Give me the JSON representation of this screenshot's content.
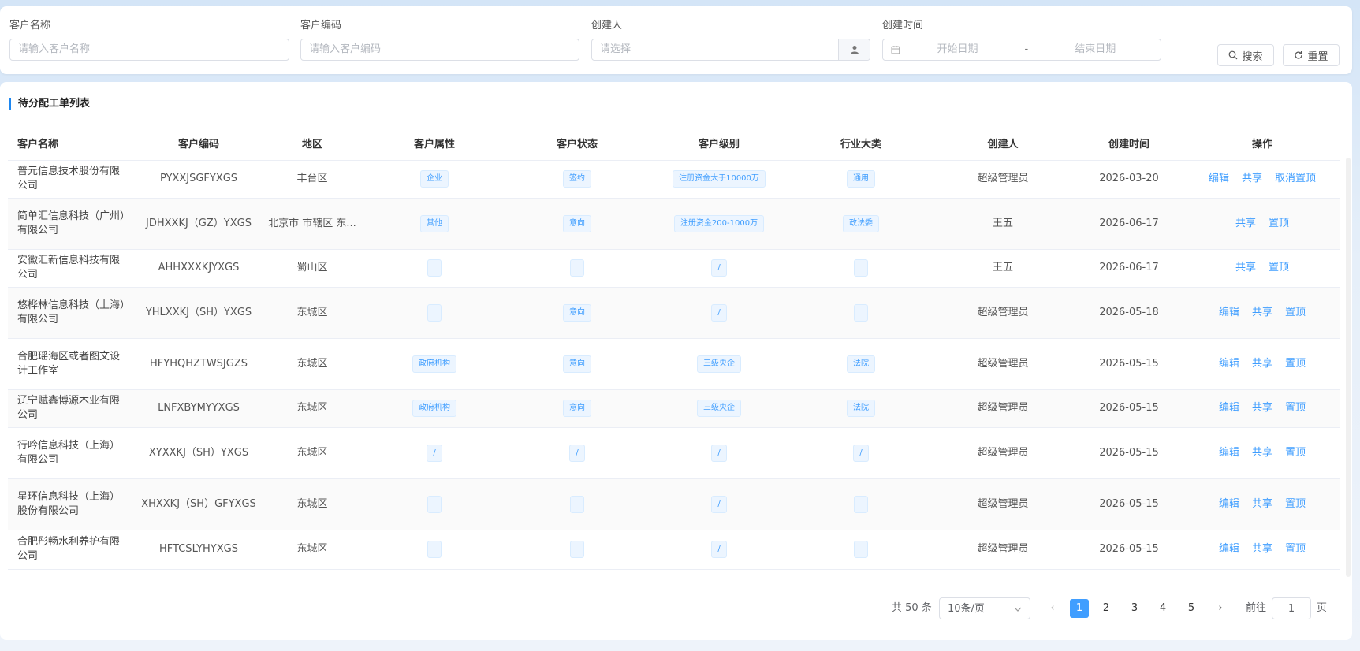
{
  "search": {
    "customer_name": {
      "label": "客户名称",
      "placeholder": "请输入客户名称"
    },
    "customer_code": {
      "label": "客户编码",
      "placeholder": "请输入客户编码"
    },
    "creator": {
      "label": "创建人",
      "placeholder": "请选择"
    },
    "create_time": {
      "label": "创建时间",
      "start_placeholder": "开始日期",
      "separator": "-",
      "end_placeholder": "结束日期"
    },
    "search_button": "搜索",
    "reset_button": "重置"
  },
  "table": {
    "title": "待分配工单列表",
    "columns": [
      "客户名称",
      "客户编码",
      "地区",
      "客户属性",
      "客户状态",
      "客户级别",
      "行业大类",
      "创建人",
      "创建时间",
      "操作"
    ],
    "rows": [
      {
        "name": "普元信息技术股份有限公司",
        "code": "PYXXJSGFYXGS",
        "region": "丰台区",
        "attr": "企业",
        "status": "签约",
        "level": "注册资金大于10000万",
        "industry": "通用",
        "creator": "超级管理员",
        "created": "2026-03-20",
        "ops": [
          "编辑",
          "共享",
          "取消置顶"
        ]
      },
      {
        "name": "简单汇信息科技（广州）有限公司",
        "code": "JDHXXKJ（GZ）YXGS",
        "region": "北京市 市辖区 东...",
        "attr": "其他",
        "status": "意向",
        "level": "注册资金200-1000万",
        "industry": "政法委",
        "creator": "王五",
        "created": "2026-06-17",
        "ops": [
          "共享",
          "置顶"
        ]
      },
      {
        "name": "安徽汇新信息科技有限公司",
        "code": "AHHXXXKJYXGS",
        "region": "蜀山区",
        "attr": "",
        "status": "",
        "level": "/",
        "industry": "",
        "creator": "王五",
        "created": "2026-06-17",
        "ops": [
          "共享",
          "置顶"
        ]
      },
      {
        "name": "悠桦林信息科技（上海）有限公司",
        "code": "YHLXXKJ（SH）YXGS",
        "region": "东城区",
        "attr": "",
        "status": "意向",
        "level": "/",
        "industry": "",
        "creator": "超级管理员",
        "created": "2026-05-18",
        "ops": [
          "编辑",
          "共享",
          "置顶"
        ]
      },
      {
        "name": "合肥瑶海区或者图文设计工作室",
        "code": "HFYHQHZTWSJGZS",
        "region": "东城区",
        "attr": "政府机构",
        "status": "意向",
        "level": "三级央企",
        "industry": "法院",
        "creator": "超级管理员",
        "created": "2026-05-15",
        "ops": [
          "编辑",
          "共享",
          "置顶"
        ]
      },
      {
        "name": "辽宁赋鑫博源木业有限公司",
        "code": "LNFXBYMYYXGS",
        "region": "东城区",
        "attr": "政府机构",
        "status": "意向",
        "level": "三级央企",
        "industry": "法院",
        "creator": "超级管理员",
        "created": "2026-05-15",
        "ops": [
          "编辑",
          "共享",
          "置顶"
        ]
      },
      {
        "name": "行吟信息科技（上海）有限公司",
        "code": "XYXXKJ（SH）YXGS",
        "region": "东城区",
        "attr": "/",
        "status": "/",
        "level": "/",
        "industry": "/",
        "creator": "超级管理员",
        "created": "2026-05-15",
        "ops": [
          "编辑",
          "共享",
          "置顶"
        ]
      },
      {
        "name": "星环信息科技（上海）股份有限公司",
        "code": "XHXXKJ（SH）GFYXGS",
        "region": "东城区",
        "attr": "",
        "status": "",
        "level": "/",
        "industry": "",
        "creator": "超级管理员",
        "created": "2026-05-15",
        "ops": [
          "编辑",
          "共享",
          "置顶"
        ]
      },
      {
        "name": "合肥彤畅水利养护有限公司",
        "code": "HFTCSLYHYXGS",
        "region": "东城区",
        "attr": "",
        "status": "",
        "level": "/",
        "industry": "",
        "creator": "超级管理员",
        "created": "2026-05-15",
        "ops": [
          "编辑",
          "共享",
          "置顶"
        ]
      }
    ]
  },
  "pagination": {
    "total_text": "共 50 条",
    "page_size": "10条/页",
    "prev": "‹",
    "pages": [
      "1",
      "2",
      "3",
      "4",
      "5"
    ],
    "current_page": 1,
    "next": "›",
    "goto_label": "前往",
    "goto_value": "1",
    "goto_unit": "页"
  },
  "colors": {
    "accent": "#409eff",
    "title_bar": "#1e87f0"
  }
}
